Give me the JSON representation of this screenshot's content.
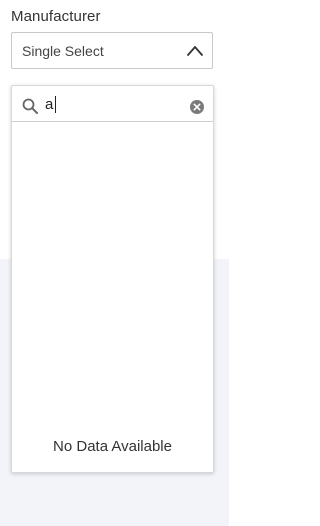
{
  "field": {
    "label": "Manufacturer",
    "selected_value": "Single Select"
  },
  "search": {
    "value": "a",
    "placeholder": ""
  },
  "dropdown": {
    "empty_message": "No Data Available"
  },
  "icons": {
    "chevron": "chevron-up-icon",
    "search": "search-icon",
    "clear": "clear-circle-icon"
  },
  "colors": {
    "lower_background": "#f3f3fa",
    "border": "#c8c8c8",
    "text": "#333333"
  }
}
